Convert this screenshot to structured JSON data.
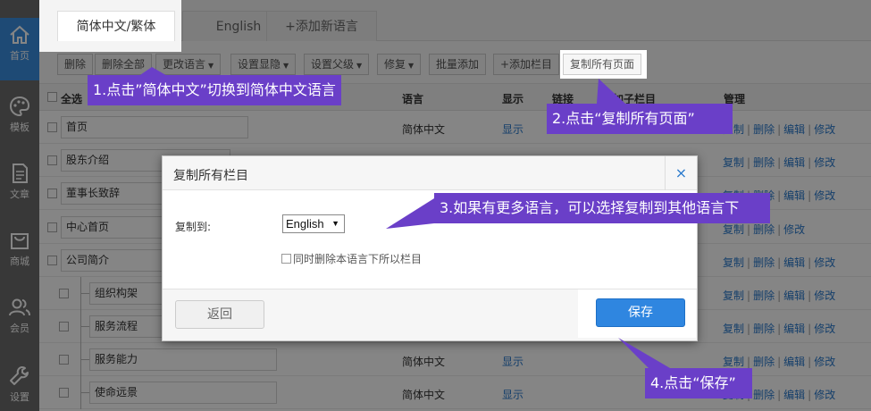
{
  "sidebar": {
    "items": [
      {
        "label": "首页",
        "icon": "home-icon"
      },
      {
        "label": "模板",
        "icon": "palette-icon"
      },
      {
        "label": "文章",
        "icon": "document-icon"
      },
      {
        "label": "商城",
        "icon": "shopping-bag-icon"
      },
      {
        "label": "会员",
        "icon": "users-icon"
      },
      {
        "label": "设置",
        "icon": "wrench-icon"
      }
    ]
  },
  "tabs": [
    {
      "label": "简体中文/繁体"
    },
    {
      "label": "English"
    },
    {
      "label": "+添加新语言"
    }
  ],
  "toolbar": {
    "buttons": [
      {
        "label": "删除"
      },
      {
        "label": "删除全部"
      },
      {
        "label": "更改语言"
      },
      {
        "label": "设置显隐"
      },
      {
        "label": "设置父级"
      },
      {
        "label": "修复"
      },
      {
        "label": "批量添加"
      },
      {
        "label": "+添加栏目"
      },
      {
        "label": "复制所有页面"
      }
    ]
  },
  "table": {
    "headers": {
      "select_all": "全选",
      "language": "语言",
      "display": "显示",
      "link": "链接",
      "add_child": "添加子栏目",
      "manage": "管理"
    },
    "rows": [
      {
        "name": "首页",
        "language": "简体中文",
        "display": "显示"
      },
      {
        "name": "股东介绍"
      },
      {
        "name": "董事长致辞"
      },
      {
        "name": "中心首页"
      },
      {
        "name": "公司简介"
      },
      {
        "name": "组织构架"
      },
      {
        "name": "服务流程"
      },
      {
        "name": "服务能力",
        "language": "简体中文",
        "display": "显示"
      },
      {
        "name": "使命远景",
        "language": "简体中文",
        "display": "显示"
      }
    ],
    "actions": {
      "copy": "复制",
      "delete": "删除",
      "edit": "编辑",
      "modify": "修改"
    }
  },
  "dialog": {
    "title": "复制所有栏目",
    "close": "×",
    "copy_to_label": "复制到:",
    "selected_language": "English",
    "checkbox_label": "同时删除本语言下所以栏目",
    "back_button": "返回",
    "save_button": "保存"
  },
  "callouts": {
    "step1": "1.点击”简体中文”切换到简体中文语言",
    "step2": "2.点击“复制所有页面”",
    "step3": "3.如果有更多语言，可以选择复制到其他语言下",
    "step4": "4.点击“保存”"
  },
  "colors": {
    "callout": "#6a3fc8",
    "accent": "#2f86e0",
    "sidebar": "#6c6c6c",
    "link": "#2a7acd"
  }
}
